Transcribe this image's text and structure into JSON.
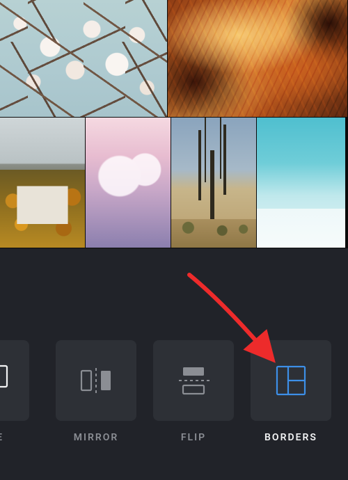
{
  "gallery": {
    "row1": [
      {
        "name": "cherry-blossom"
      },
      {
        "name": "antelope-canyon"
      }
    ],
    "row2": [
      {
        "name": "autumn-house"
      },
      {
        "name": "pink-mountain"
      },
      {
        "name": "joshua-tree"
      },
      {
        "name": "snow-peak"
      }
    ]
  },
  "tools": {
    "replace": {
      "label": "LACE"
    },
    "mirror": {
      "label": "MIRROR"
    },
    "flip": {
      "label": "FLIP"
    },
    "borders": {
      "label": "BORDERS"
    }
  },
  "colors": {
    "accent_blue": "#3d8fe8",
    "panel_bg": "#212329",
    "tile_bg": "#2d3036",
    "label_inactive": "#8b8e94",
    "label_active": "#f3f4f5",
    "annotation_red": "#ed2b2b"
  },
  "annotation": {
    "type": "arrow",
    "target": "borders-tool"
  }
}
